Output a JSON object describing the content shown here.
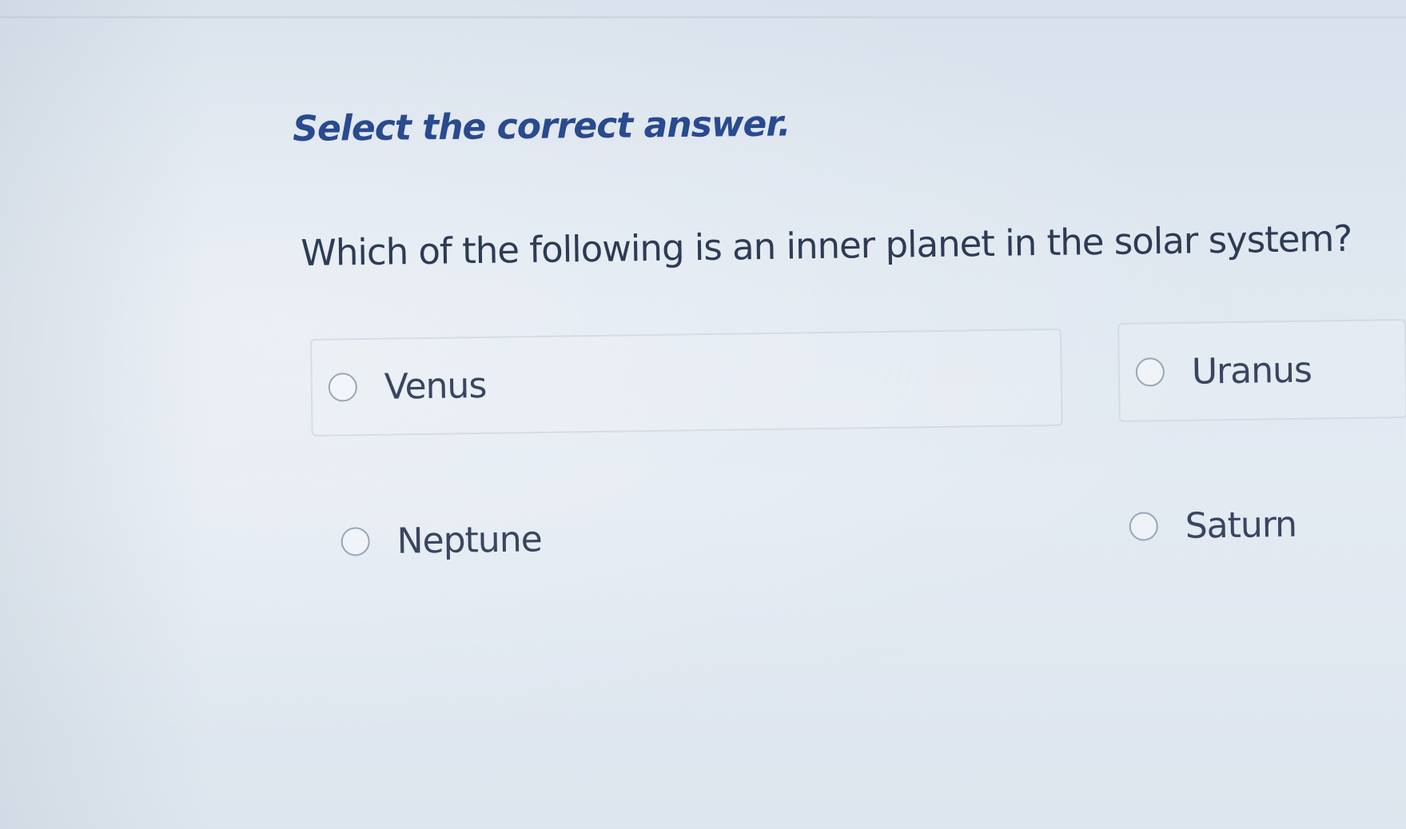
{
  "instruction": "Select the correct answer.",
  "question": "Which of the following is an inner planet in the solar system?",
  "options": [
    {
      "label": "Venus",
      "selected": false
    },
    {
      "label": "Uranus",
      "selected": false
    },
    {
      "label": "Neptune",
      "selected": false
    },
    {
      "label": "Saturn",
      "selected": false
    }
  ],
  "colors": {
    "instruction_text": "#2a4a8f",
    "question_text": "#2d3b55",
    "option_text": "#3a4660",
    "radio_border": "#9aa6b6",
    "background": "#dfe7f0"
  }
}
